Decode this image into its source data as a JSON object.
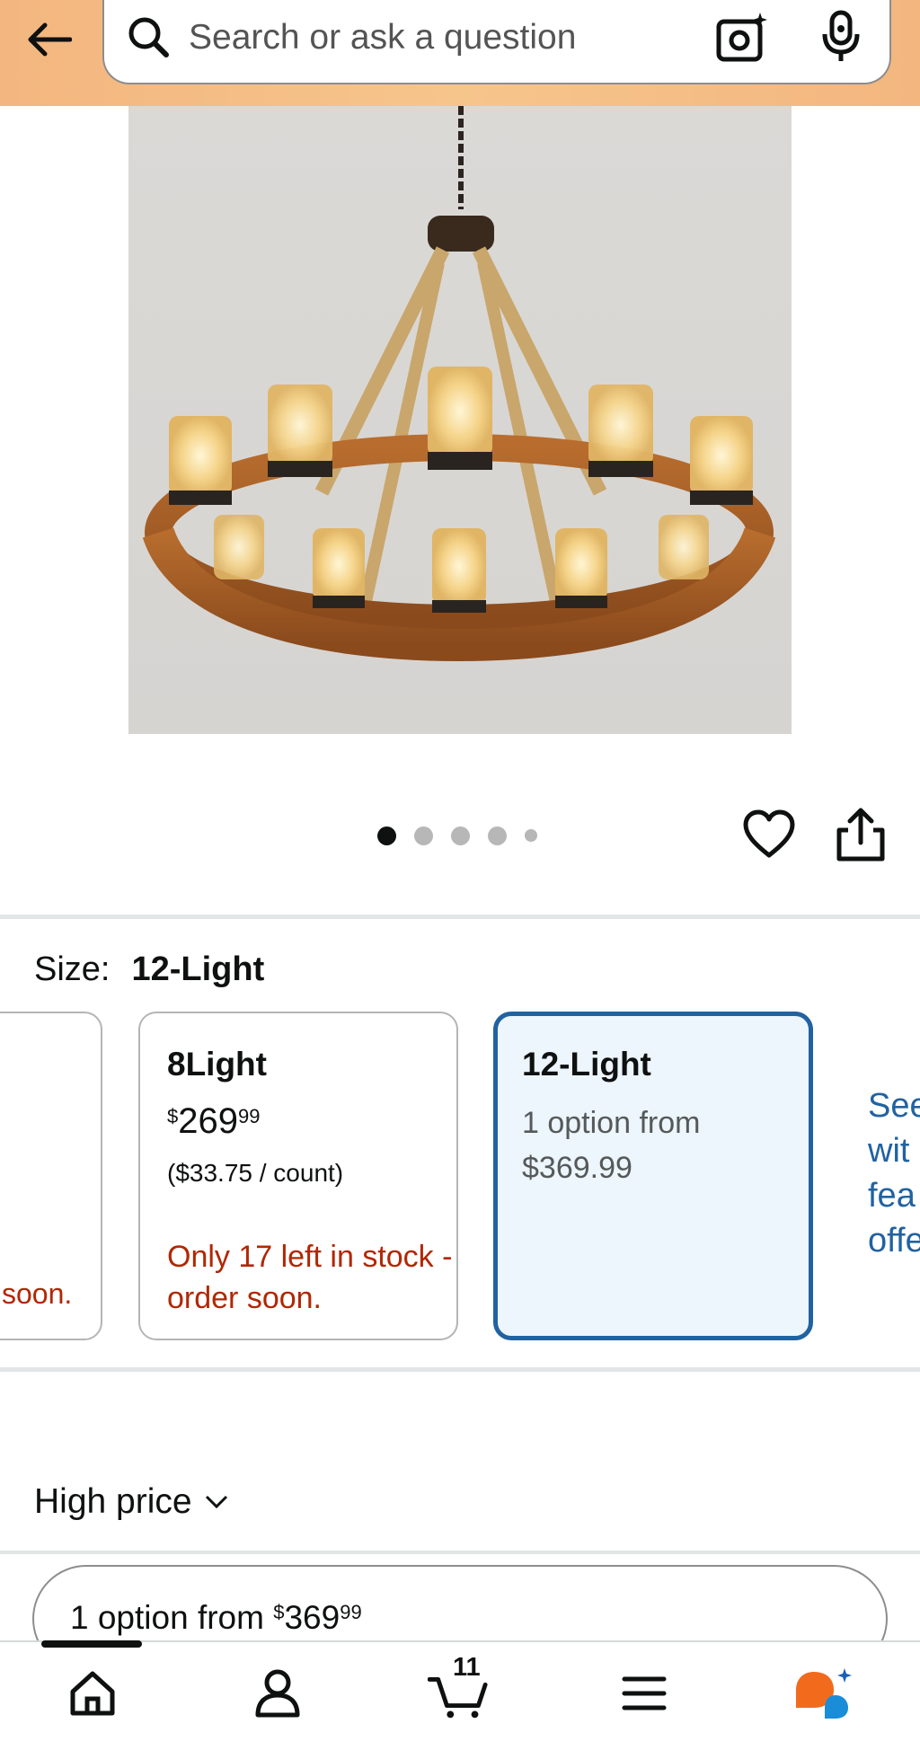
{
  "search": {
    "placeholder": "Search or ask a question"
  },
  "carousel": {
    "total_images": 5,
    "active_index": 0
  },
  "size": {
    "label": "Size:",
    "value": "12-Light"
  },
  "options": {
    "left_partial": {
      "stock_text": "soon."
    },
    "light8": {
      "title": "8Light",
      "price_currency": "$",
      "price_whole": "269",
      "price_fraction": "99",
      "unit_price": "($33.75 / count)",
      "stock": "Only 17 left in stock - order soon."
    },
    "light12": {
      "title": "12-Light",
      "availability": "1 option from $369.99"
    },
    "see_more": "See wit fea offe"
  },
  "sort": {
    "label": "High price"
  },
  "offer_pill": {
    "prefix": "1 option from ",
    "currency": "$",
    "whole": "369",
    "fraction": "99"
  },
  "bottom_nav": {
    "cart_count": "11"
  },
  "colors": {
    "header_bg": "#f3b67f",
    "link_blue": "#2162a1",
    "stock_red": "#b12704",
    "selected_card_bg": "#edf5fd"
  },
  "icons": [
    "back-arrow-icon",
    "search-icon",
    "camera-icon",
    "mic-icon",
    "heart-icon",
    "share-icon",
    "chevron-down-icon",
    "home-icon",
    "account-icon",
    "cart-icon",
    "menu-icon",
    "rufus-icon"
  ]
}
